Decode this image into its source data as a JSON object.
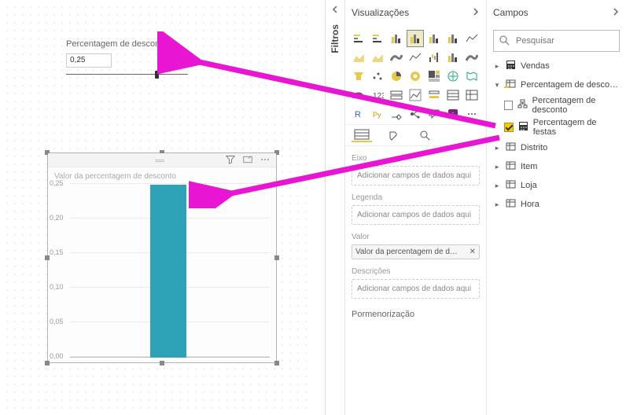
{
  "panes": {
    "filters": "Filtros",
    "viz_title": "Visualizações",
    "campos_title": "Campos"
  },
  "slicer": {
    "title": "Percentagem de desconto",
    "value": "0,25"
  },
  "chart": {
    "title": "Valor da percentagem de desconto"
  },
  "chart_data": {
    "type": "bar",
    "categories": [
      ""
    ],
    "values": [
      0.25
    ],
    "title": "Valor da percentagem de desconto",
    "xlabel": "",
    "ylabel": "",
    "ylim": [
      0,
      0.25
    ],
    "ticks": [
      0.0,
      0.05,
      0.1,
      0.15,
      0.2,
      0.25
    ],
    "tick_labels": [
      "0,00",
      "0,05",
      "0,10",
      "0,15",
      "0,20",
      "0,25"
    ]
  },
  "wells": {
    "eixo_label": "Eixo",
    "eixo_placeholder": "Adicionar campos de dados aqui",
    "legenda_label": "Legenda",
    "legenda_placeholder": "Adicionar campos de dados aqui",
    "valor_label": "Valor",
    "valor_field": "Valor da percentagem de desconto",
    "descricoes_label": "Descrições",
    "descricoes_placeholder": "Adicionar campos de dados aqui",
    "pormenor_label": "Pormenorização"
  },
  "search": {
    "placeholder": "Pesquisar"
  },
  "tables": [
    {
      "name": "Vendas",
      "expanded": false,
      "icon": "calc"
    },
    {
      "name": "Percentagem de desconto",
      "expanded": true,
      "icon": "table-y",
      "fields": [
        {
          "name": "Percentagem de desconto",
          "checked": false,
          "icon": "hier"
        },
        {
          "name": "Percentagem de festas",
          "checked": true,
          "icon": "calc"
        }
      ]
    },
    {
      "name": "Distrito",
      "expanded": false,
      "icon": "table"
    },
    {
      "name": "Item",
      "expanded": false,
      "icon": "table"
    },
    {
      "name": "Loja",
      "expanded": false,
      "icon": "table"
    },
    {
      "name": "Hora",
      "expanded": false,
      "icon": "table"
    }
  ]
}
